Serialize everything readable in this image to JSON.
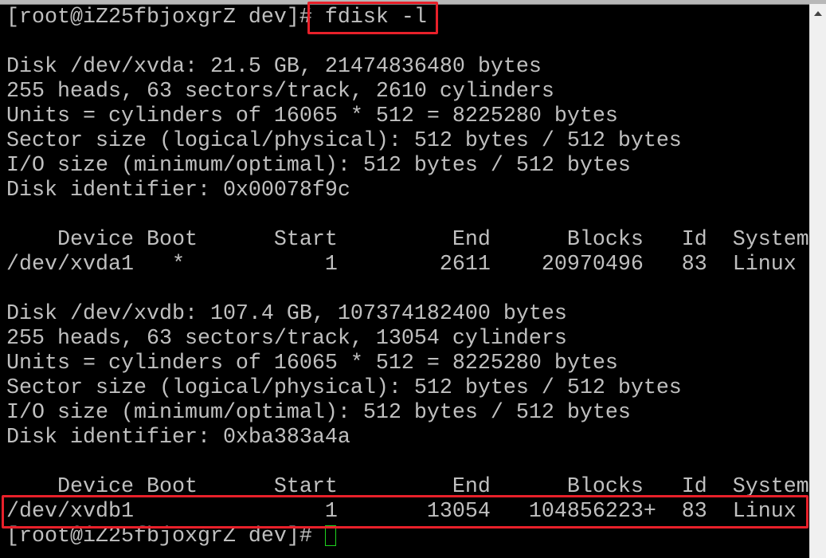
{
  "terminal": {
    "lines": [
      "[root@iZ25fbjoxgrZ dev]# fdisk -l",
      "",
      "Disk /dev/xvda: 21.5 GB, 21474836480 bytes",
      "255 heads, 63 sectors/track, 2610 cylinders",
      "Units = cylinders of 16065 * 512 = 8225280 bytes",
      "Sector size (logical/physical): 512 bytes / 512 bytes",
      "I/O size (minimum/optimal): 512 bytes / 512 bytes",
      "Disk identifier: 0x00078f9c",
      "",
      "    Device Boot      Start         End      Blocks   Id  System",
      "/dev/xvda1   *           1        2611    20970496   83  Linux",
      "",
      "Disk /dev/xvdb: 107.4 GB, 107374182400 bytes",
      "255 heads, 63 sectors/track, 13054 cylinders",
      "Units = cylinders of 16065 * 512 = 8225280 bytes",
      "Sector size (logical/physical): 512 bytes / 512 bytes",
      "I/O size (minimum/optimal): 512 bytes / 512 bytes",
      "Disk identifier: 0xba383a4a",
      "",
      "    Device Boot      Start         End      Blocks   Id  System",
      "/dev/xvdb1               1       13054   104856223+  83  Linux"
    ],
    "prompt": "[root@iZ25fbjoxgrZ dev]# "
  },
  "colors": {
    "text": "#c0c0c0",
    "background": "#000000",
    "highlight": "#e8202a",
    "cursor": "#1fd31f"
  },
  "icons": {
    "scroll_up": "triangle-up-icon"
  }
}
